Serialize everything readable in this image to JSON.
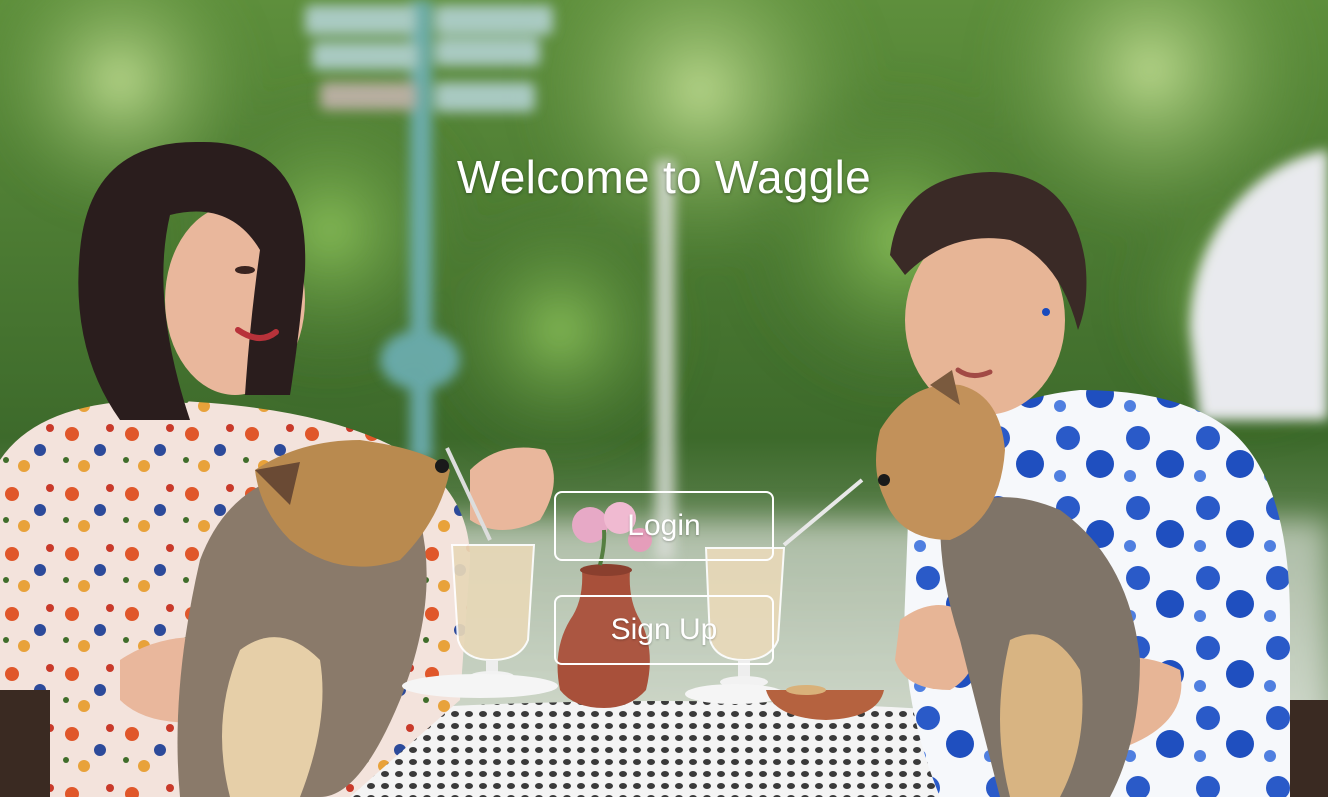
{
  "page": {
    "title": "Welcome to Waggle"
  },
  "actions": {
    "login_label": "Login",
    "signup_label": "Sign Up"
  },
  "colors": {
    "text": "#ffffff",
    "button_border": "#ffffff"
  },
  "background": {
    "image": "photo-two-women-with-yorkshire-terriers-at-cafe-table"
  }
}
